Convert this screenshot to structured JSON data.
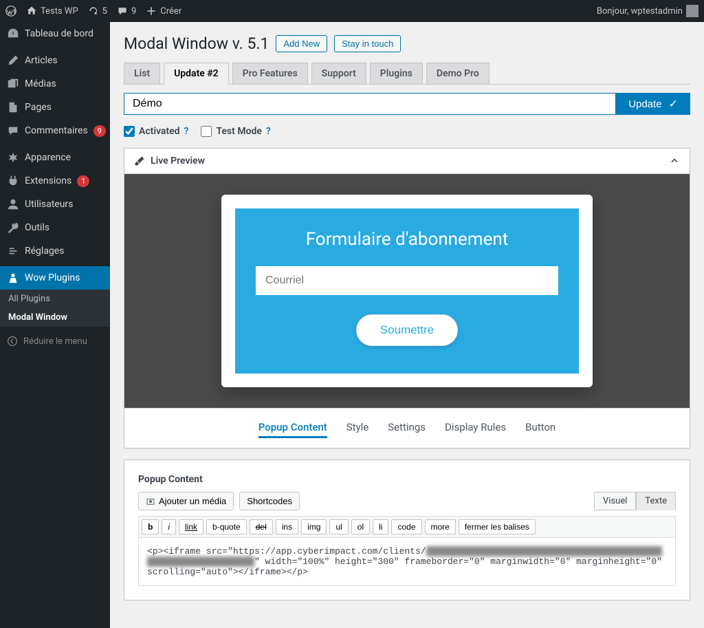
{
  "adminbar": {
    "site_name": "Tests WP",
    "updates_count": "5",
    "comments_count": "9",
    "create": "Créer",
    "greeting": "Bonjour, wptestadmin"
  },
  "sidebar": {
    "dashboard": "Tableau de bord",
    "posts": "Articles",
    "media": "Médias",
    "pages": "Pages",
    "comments": "Commentaires",
    "comments_badge": "9",
    "appearance": "Apparence",
    "plugins": "Extensions",
    "plugins_badge": "1",
    "users": "Utilisateurs",
    "tools": "Outils",
    "settings": "Réglages",
    "wow": "Wow Plugins",
    "sub_all": "All Plugins",
    "sub_modal": "Modal Window",
    "collapse": "Réduire le menu"
  },
  "header": {
    "title": "Modal Window v. 5.1",
    "add_new": "Add New",
    "stay": "Stay in touch"
  },
  "tabs": {
    "list": "List",
    "update": "Update #2",
    "pro": "Pro Features",
    "support": "Support",
    "plugins": "Plugins",
    "demo": "Demo Pro"
  },
  "form": {
    "title_value": "Démo",
    "update_btn": "Update",
    "activated": "Activated",
    "test_mode": "Test Mode"
  },
  "preview": {
    "panel_title": "Live Preview",
    "modal_heading": "Formulaire d'abonnement",
    "email_placeholder": "Courriel",
    "submit": "Soumettre"
  },
  "subtabs": {
    "popup": "Popup Content",
    "style": "Style",
    "settings": "Settings",
    "display": "Display Rules",
    "button": "Button"
  },
  "editor": {
    "heading": "Popup Content",
    "add_media": "Ajouter un média",
    "shortcodes": "Shortcodes",
    "visual": "Visuel",
    "text": "Texte",
    "btns": {
      "b": "b",
      "i": "i",
      "link": "link",
      "bquote": "b-quote",
      "del": "del",
      "ins": "ins",
      "img": "img",
      "ul": "ul",
      "ol": "ol",
      "li": "li",
      "code": "code",
      "more": "more",
      "close": "fermer les balises"
    },
    "code_pre": "<p><iframe src=\"https://app.cyberimpact.com/clients/",
    "code_blur": "xxxxxxxxxxxxxxxxxxxxxxxxxxxxxxxxxxxxxxxxxxxxxxxxxxxxxxxxxxxxxxxx",
    "code_post": "\" width=\"100%\" height=\"300\" frameborder=\"0\" marginwidth=\"0\" marginheight=\"0\" scrolling=\"auto\"></iframe></p>"
  }
}
